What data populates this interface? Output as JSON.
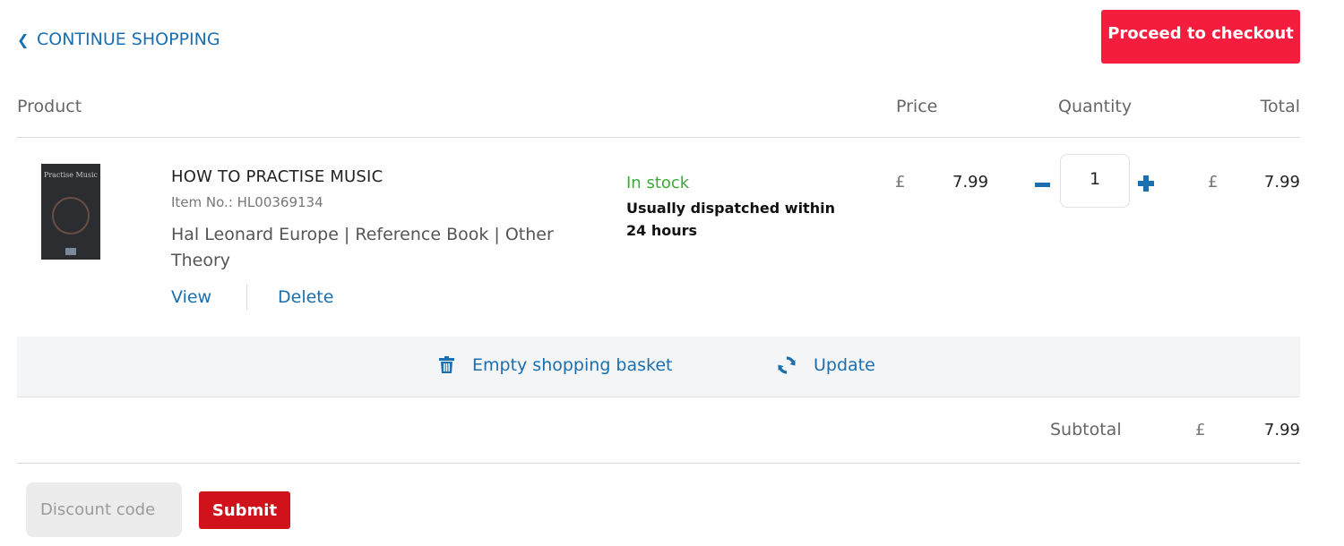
{
  "nav": {
    "continue_label": "CONTINUE SHOPPING",
    "checkout_label": "Proceed to checkout"
  },
  "table": {
    "headers": {
      "product": "Product",
      "price": "Price",
      "quantity": "Quantity",
      "total": "Total"
    }
  },
  "item": {
    "cover_title": "Practise Music",
    "name": "HOW TO PRACTISE MUSIC",
    "item_no": "Item No.: HL00369134",
    "meta": "Hal Leonard Europe | Reference Book | Other Theory",
    "view_label": "View",
    "delete_label": "Delete",
    "stock": "In stock",
    "dispatch": "Usually dispatched within 24 hours",
    "currency": "£",
    "price": "7.99",
    "quantity": "1",
    "total": "7.99"
  },
  "actions": {
    "empty_label": "Empty shopping basket",
    "update_label": "Update"
  },
  "summary": {
    "subtotal_label": "Subtotal",
    "currency": "£",
    "subtotal": "7.99"
  },
  "discount": {
    "placeholder": "Discount code",
    "submit_label": "Submit"
  },
  "colors": {
    "accent": "#1a6fb0",
    "checkout": "#f41d3d",
    "submit": "#d0131b",
    "stock": "#3aaa35"
  },
  "icons": {
    "back": "chevron-left-icon",
    "trash": "trash-icon",
    "refresh": "refresh-icon",
    "minus": "minus-icon",
    "plus": "plus-icon"
  }
}
